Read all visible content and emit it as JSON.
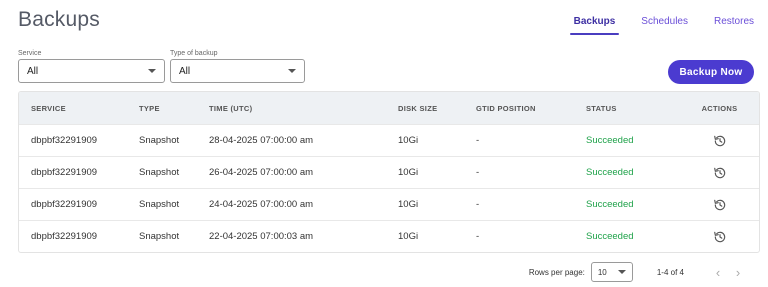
{
  "page": {
    "title": "Backups"
  },
  "tabs": [
    {
      "label": "Backups",
      "active": true
    },
    {
      "label": "Schedules",
      "active": false
    },
    {
      "label": "Restores",
      "active": false
    }
  ],
  "filters": {
    "service": {
      "label": "Service",
      "value": "All"
    },
    "type": {
      "label": "Type of backup",
      "value": "All"
    }
  },
  "actions": {
    "backup_now": "Backup Now"
  },
  "table": {
    "headers": [
      "SERVICE",
      "TYPE",
      "TIME (UTC)",
      "DISK SIZE",
      "GTID POSITION",
      "STATUS",
      "ACTIONS"
    ],
    "rows": [
      {
        "service": "dbpbf32291909",
        "type": "Snapshot",
        "time": "28-04-2025 07:00:00 am",
        "size": "10Gi",
        "gtid": "-",
        "status": "Succeeded"
      },
      {
        "service": "dbpbf32291909",
        "type": "Snapshot",
        "time": "26-04-2025 07:00:00 am",
        "size": "10Gi",
        "gtid": "-",
        "status": "Succeeded"
      },
      {
        "service": "dbpbf32291909",
        "type": "Snapshot",
        "time": "24-04-2025 07:00:00 am",
        "size": "10Gi",
        "gtid": "-",
        "status": "Succeeded"
      },
      {
        "service": "dbpbf32291909",
        "type": "Snapshot",
        "time": "22-04-2025 07:00:03 am",
        "size": "10Gi",
        "gtid": "-",
        "status": "Succeeded"
      }
    ],
    "action_icon": "restore-icon"
  },
  "pagination": {
    "rows_per_page_label": "Rows per page:",
    "rows_per_page": "10",
    "range": "1-4 of 4",
    "prev_icon": "chevron-left-icon",
    "next_icon": "chevron-right-icon"
  },
  "colors": {
    "accent": "#4b3bd0",
    "success": "#1fa24a",
    "header_bg": "#eef1f4"
  }
}
